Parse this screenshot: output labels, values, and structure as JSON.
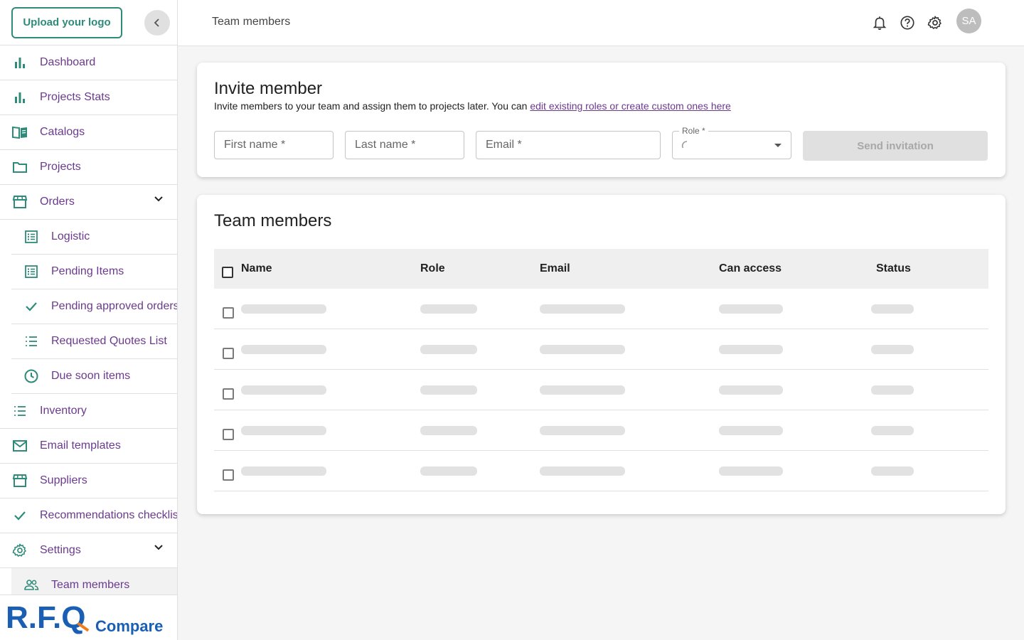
{
  "sidebar": {
    "upload_logo_label": "Upload your logo",
    "items": [
      {
        "label": "Dashboard"
      },
      {
        "label": "Projects Stats"
      },
      {
        "label": "Catalogs"
      },
      {
        "label": "Projects"
      },
      {
        "label": "Orders"
      },
      {
        "label": "Logistic"
      },
      {
        "label": "Pending Items"
      },
      {
        "label": "Pending approved orders"
      },
      {
        "label": "Requested Quotes List"
      },
      {
        "label": "Due soon items"
      },
      {
        "label": "Inventory"
      },
      {
        "label": "Email templates"
      },
      {
        "label": "Suppliers"
      },
      {
        "label": "Recommendations checklist"
      },
      {
        "label": "Settings"
      },
      {
        "label": "Team members"
      }
    ],
    "brand_logo": {
      "main": "R.F.Q",
      "sub": "Compare"
    }
  },
  "header": {
    "title": "Team members",
    "avatar_initials": "SA"
  },
  "invite": {
    "title": "Invite member",
    "description": "Invite members to your team and assign them to projects later. You can ",
    "link_text": "edit existing roles or create custom ones here",
    "first_name_placeholder": "First name *",
    "last_name_placeholder": "Last name *",
    "email_placeholder": "Email *",
    "role_label": "Role *",
    "send_label": "Send invitation"
  },
  "team": {
    "title": "Team members",
    "columns": [
      "Name",
      "Role",
      "Email",
      "Can access",
      "Status"
    ]
  },
  "colors": {
    "accent_teal": "#2e8b7a",
    "nav_text_purple": "#6b3a8e",
    "brand_blue": "#1a5fb4",
    "brand_orange": "#f07c1b"
  }
}
